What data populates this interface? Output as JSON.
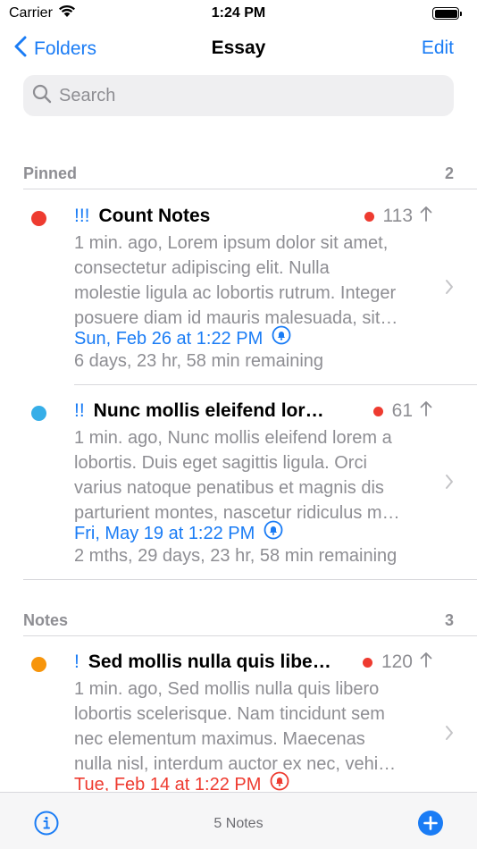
{
  "status": {
    "carrier": "Carrier",
    "time": "1:24 PM"
  },
  "nav": {
    "back_label": "Folders",
    "title": "Essay",
    "edit_label": "Edit"
  },
  "search": {
    "placeholder": "Search"
  },
  "sections": [
    {
      "title": "Pinned",
      "count": "2"
    },
    {
      "title": "Notes",
      "count": "3"
    }
  ],
  "notes": [
    {
      "priority": "!!!",
      "title": "Count Notes",
      "count": "113",
      "dot_color": "#ee3b30",
      "lines": [
        "1 min. ago, Lorem ipsum dolor sit amet,",
        "consectetur adipiscing elit. Nulla",
        "molestie ligula ac lobortis rutrum. Integer",
        "posuere diam id mauris malesuada, sit…"
      ],
      "due": "Sun, Feb 26 at 1:22 PM",
      "due_color": "#1a7cf5",
      "remaining": "6 days, 23 hr, 58 min remaining"
    },
    {
      "priority": "!!",
      "title": "Nunc mollis eleifend lore…",
      "count": "61",
      "dot_color": "#36aee8",
      "lines": [
        "1 min. ago, Nunc mollis eleifend lorem a",
        "lobortis. Duis eget sagittis ligula. Orci",
        "varius natoque penatibus et magnis dis",
        "parturient montes, nascetur ridiculus m…"
      ],
      "due": "Fri, May 19 at 1:22 PM",
      "due_color": "#1a7cf5",
      "remaining": "2 mths, 29 days, 23 hr, 58 min remaining"
    },
    {
      "priority": "!",
      "title": "Sed mollis nulla quis liber…",
      "count": "120",
      "dot_color": "#f7950b",
      "lines": [
        "1 min. ago, Sed mollis nulla quis libero",
        "lobortis scelerisque. Nam tincidunt sem",
        "nec elementum maximus. Maecenas",
        "nulla nisl, interdum auctor ex nec, vehi…"
      ],
      "due": "Tue, Feb 14 at 1:22 PM",
      "due_color": "#ee3b30",
      "remaining": ""
    }
  ],
  "toolbar": {
    "count_label": "5 Notes"
  },
  "colors": {
    "accent": "#1a7cf5",
    "alert": "#ee3b30",
    "secondary": "#8e8e93"
  }
}
